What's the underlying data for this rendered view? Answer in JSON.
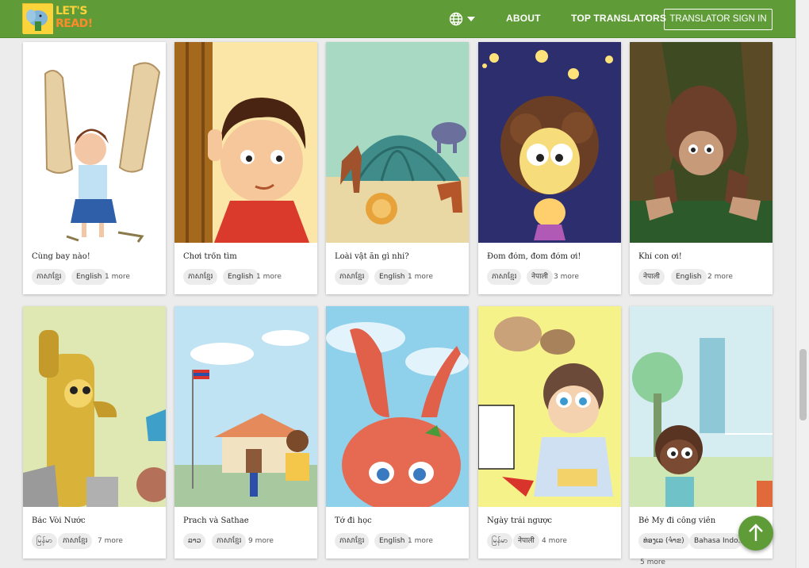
{
  "header": {
    "logo_line1": "LET'S",
    "logo_line2": "READ!",
    "about": "ABOUT",
    "top_translators": "TOP TRANSLATORS",
    "sign_in": "TRANSLATOR SIGN IN",
    "brand_color": "#5f9c38"
  },
  "books": [
    {
      "title": "Cùng bay nào!",
      "tags": [
        "ភាសាខ្មែរ",
        "English"
      ],
      "more": "1 more"
    },
    {
      "title": "Chơi trốn tìm",
      "tags": [
        "ភាសាខ្មែរ",
        "English"
      ],
      "more": "1 more"
    },
    {
      "title": "Loài vật ăn gì nhỉ?",
      "tags": [
        "ភាសាខ្មែរ",
        "English"
      ],
      "more": "1 more"
    },
    {
      "title": "Đom đóm, đom đóm ơi!",
      "tags": [
        "ភាសាខ្មែរ",
        "नेपाली"
      ],
      "more": "3 more"
    },
    {
      "title": "Khỉ con ơi!",
      "tags": [
        "नेपाली",
        "English"
      ],
      "more": "2 more"
    },
    {
      "title": "Bác Vòi Nước",
      "tags": [
        "မြန်မာ",
        "ភាសាខ្មែរ"
      ],
      "more": "7 more"
    },
    {
      "title": "Prach và Sathae",
      "tags": [
        "ລາວ",
        "ភាសាខ្មែរ"
      ],
      "more": "9 more"
    },
    {
      "title": "Tớ đi học",
      "tags": [
        "ភាសាខ្មែរ",
        "English"
      ],
      "more": "1 more"
    },
    {
      "title": "Ngày trái ngược",
      "tags": [
        "မြန်မာ",
        "नेपाली"
      ],
      "more": "4 more"
    },
    {
      "title": "Bé My đi công viên",
      "tags": [
        "ທ່ອງເລ (ຈຳຂ)",
        "Bahasa Indo..."
      ],
      "more": "5 more"
    }
  ],
  "icons": {
    "language": "globe-icon",
    "dropdown": "chevron-down-icon",
    "scroll_top": "arrow-up-icon"
  }
}
